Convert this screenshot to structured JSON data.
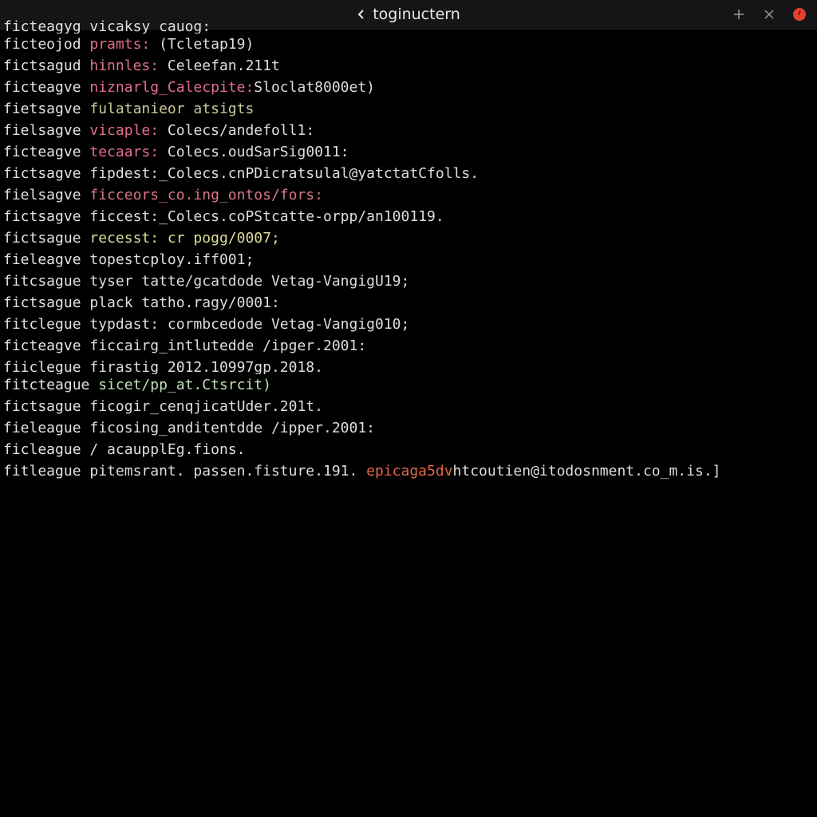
{
  "window": {
    "title": "toginuctern",
    "icons": {
      "back": "chevron-left-icon",
      "new_tab": "plus-icon",
      "minimize": "x-icon",
      "close": "close-dot-icon"
    },
    "colors": {
      "background": "#000000",
      "titlebar": "#151515",
      "close": "#e5402f"
    }
  },
  "terminal": {
    "colors": {
      "prefix": "#e2e2e2",
      "pink": "#e46f8c",
      "rose": "#d9748a",
      "olive": "#c9c99a",
      "green": "#bfe0b6",
      "yellow": "#dddd9a",
      "white": "#dedede",
      "orange": "#e06a4a"
    },
    "lines": [
      {
        "prefix": "ficteagyg",
        "text": " vicaksy_cauog:",
        "color": "white"
      },
      {
        "prefix": "ficteojod",
        "key": " pramts:",
        "key_color": "pink",
        "text": " (Tcletap19)",
        "color": "white"
      },
      {
        "prefix": "fictsagud",
        "key": " hinnles:",
        "key_color": "rose",
        "text": " Celeefan.211t",
        "color": "white"
      },
      {
        "prefix": "ficteagve",
        "key": " niznarlg_Calecpite:",
        "key_color": "pink",
        "text": "Sloclat8000et)",
        "color": "white"
      },
      {
        "prefix": "fietsagve",
        "key": "",
        "text": " fulatanieor atsigts",
        "color": "olive"
      },
      {
        "prefix": "fielsagve",
        "key": " vicaple:",
        "key_color": "pink",
        "text": " Colecs/andefoll1:",
        "color": "white"
      },
      {
        "prefix": "ficteagve",
        "key": " tecaars:",
        "key_color": "pink",
        "text": " Colecs.oudSarSig0011:",
        "color": "white"
      },
      {
        "prefix": "fictsagve",
        "key": "",
        "text": " fipdest:_Colecs.cnPDicratsulal@yatctatCfolls.",
        "color": "white"
      },
      {
        "prefix": "fielsagve",
        "key": "",
        "text": " ficceors_co.ing_ontos/fors:",
        "color": "rose"
      },
      {
        "prefix": "fictsagve",
        "key": "",
        "text": " ficcest:_Colecs.coPStcatte-orpp/an100119.",
        "color": "white"
      },
      {
        "prefix": "fictsague",
        "key": "",
        "text": " recesst: cr pogg/0007;",
        "color": "yellow"
      },
      {
        "prefix": "fieleagve",
        "key": "",
        "text": " topestcploy.iff001;",
        "color": "white"
      },
      {
        "prefix": "fitcsague",
        "key": "",
        "text": " tyser tatte/gcatdode Vetag-VangigU19;",
        "color": "white"
      },
      {
        "prefix": "fictsague",
        "key": "",
        "text": " plack tatho.ragy/0001:",
        "color": "white"
      },
      {
        "prefix": "fitclegue",
        "key": "",
        "text": " typdast: cormbcedode Vetag-Vangig010;",
        "color": "white"
      },
      {
        "prefix": "ficteagve",
        "key": "",
        "text": " ficcairg_intlutedde /ipger.2001:",
        "color": "white"
      },
      {
        "prefix": "fiiclegue",
        "key": "",
        "text": " firastig_2012.10997gp.2018.",
        "color": "white"
      },
      {
        "prefix": "fitcteague",
        "key": "",
        "text": " sicet/pp_at.Ctsrcit)",
        "color": "green"
      },
      {
        "prefix": "fictsague",
        "key": "",
        "text": " ficogir_cenqjicatUder.201t.",
        "color": "white"
      },
      {
        "prefix": "fieleague",
        "key": "",
        "text": " ficosing_anditentdde /ipper.2001:",
        "color": "white"
      },
      {
        "prefix": "ficleague",
        "key": "",
        "text": " / acaupplEg.fions.",
        "color": "white"
      },
      {
        "prefix": "fitleague",
        "key": "",
        "text": " pitemsrant. passen.fisture.191.",
        "color": "white",
        "tail": " epicaga5dv",
        "tail_color": "orange",
        "tail2": "htcoutien@itodosnment.co_m.is.]",
        "tail2_color": "white"
      }
    ]
  }
}
